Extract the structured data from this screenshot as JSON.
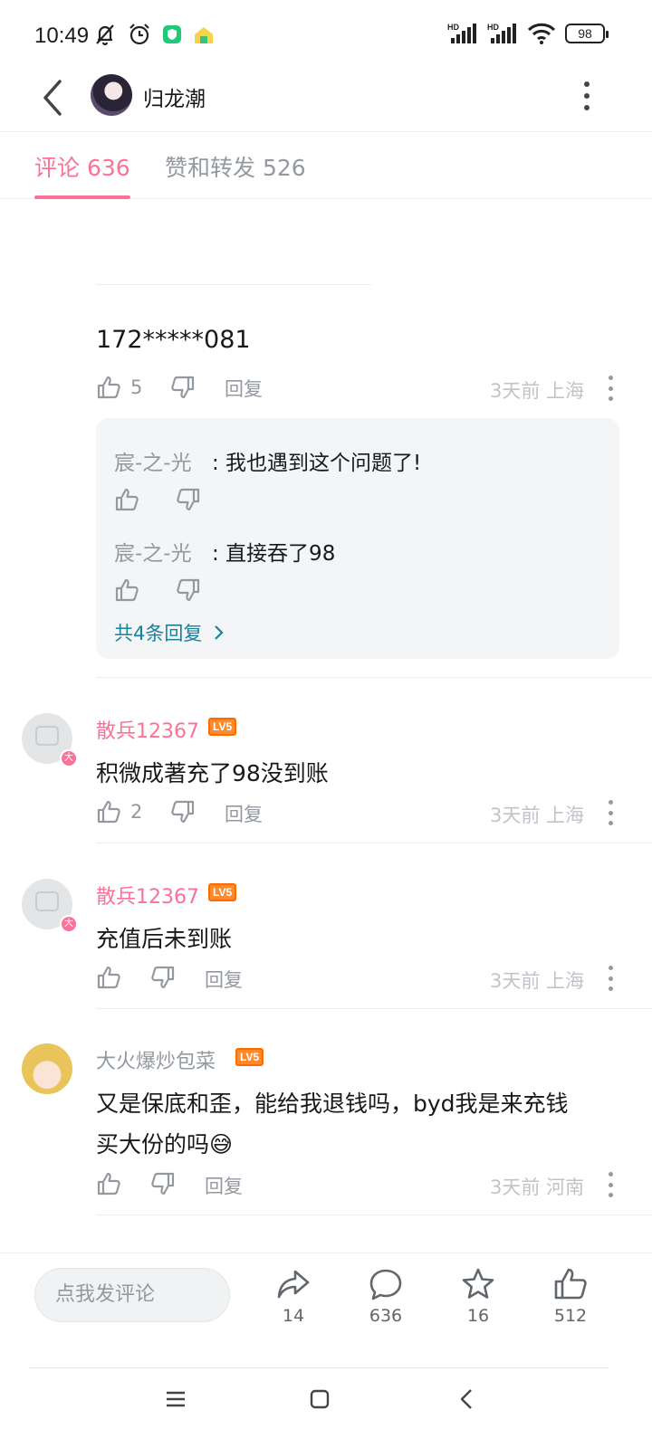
{
  "status_bar": {
    "time": "10:49",
    "battery": "98",
    "signal_labels": [
      "HD",
      "HD"
    ]
  },
  "top_bar": {
    "title": "归龙潮"
  },
  "tabs": [
    {
      "label": "评论 636",
      "active": true
    },
    {
      "label": "赞和转发 526",
      "active": false
    }
  ],
  "comments": [
    {
      "text": "172*****081",
      "likes": "5",
      "reply_label": "回复",
      "time_location": "3天前 上海",
      "replies": [
        {
          "author": "宸-之-光",
          "text": ": 我也遇到这个问题了!"
        },
        {
          "author": "宸-之-光",
          "text": ": 直接吞了98"
        }
      ],
      "more_replies": "共4条回复"
    },
    {
      "author": "散兵12367",
      "level": "LV5",
      "text": "积微成著充了98没到账",
      "likes": "2",
      "reply_label": "回复",
      "time_location": "3天前 上海"
    },
    {
      "author": "散兵12367",
      "level": "LV5",
      "text": "充值后未到账",
      "likes": "",
      "reply_label": "回复",
      "time_location": "3天前 上海"
    },
    {
      "author": "大火爆炒包菜",
      "level": "LV5",
      "text_line1": "又是保底和歪，能给我退钱吗，byd我是来充钱",
      "text_line2": "买大份的吗😅",
      "likes": "",
      "reply_label": "回复",
      "time_location": "3天前 河南"
    }
  ],
  "bottom_bar": {
    "input_placeholder": "点我发评论",
    "share_count": "14",
    "comment_count": "636",
    "favorite_count": "16",
    "like_count": "512"
  },
  "colors": {
    "accent": "#fb7299",
    "link": "#17819e",
    "secondary_text": "#9499a0",
    "level_badge": "#ff6a00"
  },
  "icons": {
    "back": "back-arrow-icon",
    "more": "more-vertical-icon",
    "like": "thumb-up-icon",
    "dislike": "thumb-down-icon",
    "share": "share-icon",
    "comment": "comment-bubble-icon",
    "favorite": "star-icon"
  }
}
